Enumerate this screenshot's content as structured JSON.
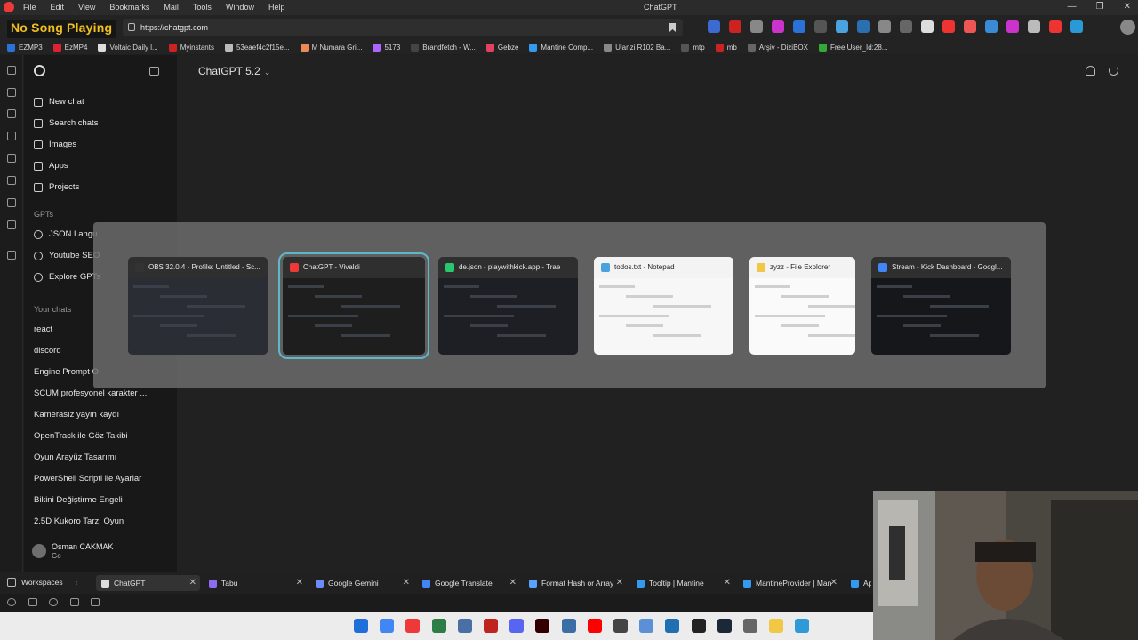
{
  "menubar": {
    "menus": [
      "File",
      "Edit",
      "View",
      "Bookmarks",
      "Mail",
      "Tools",
      "Window",
      "Help"
    ],
    "window_title": "ChatGPT"
  },
  "overlay": {
    "now_playing": "No Song Playing"
  },
  "address": {
    "url": "https://chatgpt.com"
  },
  "bookmarks": [
    {
      "label": "EZMP3",
      "color": "#2a72d8"
    },
    {
      "label": "EzMP4",
      "color": "#d23"
    },
    {
      "label": "Voltaic Daily l...",
      "color": "#ddd"
    },
    {
      "label": "Myinstants",
      "color": "#c22"
    },
    {
      "label": "53eaef4c2f15e...",
      "color": "#bbb"
    },
    {
      "label": "M Numara Gri...",
      "color": "#e85"
    },
    {
      "label": "5173",
      "color": "#a6f"
    },
    {
      "label": "Brandfetch - W...",
      "color": "#444"
    },
    {
      "label": "Gebze",
      "color": "#e4405f"
    },
    {
      "label": "Mantine Comp...",
      "color": "#339af0"
    },
    {
      "label": "Ulanzi R102 Ba...",
      "color": "#888"
    },
    {
      "label": "mtp",
      "color": "#555"
    },
    {
      "label": "mb",
      "color": "#c22"
    },
    {
      "label": "Arşiv - DiziBOX",
      "color": "#666"
    },
    {
      "label": "Free User_Id:28...",
      "color": "#3a3"
    }
  ],
  "sidebar": {
    "nav": [
      {
        "label": "New chat",
        "icon": "edit-icon"
      },
      {
        "label": "Search chats",
        "icon": "search-icon"
      },
      {
        "label": "Images",
        "icon": "image-icon"
      },
      {
        "label": "Apps",
        "icon": "apps-icon"
      },
      {
        "label": "Projects",
        "icon": "folder-icon"
      }
    ],
    "gpts_header": "GPTs",
    "gpts": [
      {
        "label": "JSON Langu"
      },
      {
        "label": "Youtube SEO"
      },
      {
        "label": "Explore GPTs"
      }
    ],
    "chats_header": "Your chats",
    "chats": [
      "react",
      "discord",
      "Engine Prompt O",
      "SCUM profesyonel karakter ...",
      "Kamerasız yayın kaydı",
      "OpenTrack ile Göz Takibi",
      "Oyun Arayüz Tasarımı",
      "PowerShell Scripti ile Ayarlar",
      "Bikini Değiştirme Engeli",
      "2.5D Kukoro Tarzı Oyun"
    ],
    "user": {
      "name": "Osman CAKMAK",
      "plan": "Go"
    }
  },
  "main": {
    "model": "ChatGPT 5.2"
  },
  "switcher": {
    "windows": [
      {
        "title": "OBS 32.0.4 - Profile: Untitled - Sc...",
        "icon": "obs-icon",
        "color": "#333",
        "thumb": "#2a2d33",
        "selected": false,
        "light": false
      },
      {
        "title": "ChatGPT - Vivaldi",
        "icon": "vivaldi-icon",
        "color": "#ef3939",
        "thumb": "#1e1e1e",
        "selected": true,
        "light": false
      },
      {
        "title": "de.json - playwithkick.app - Trae",
        "icon": "trae-icon",
        "color": "#28c76f",
        "thumb": "#1d1f24",
        "selected": false,
        "light": false
      },
      {
        "title": "todos.txt - Notepad",
        "icon": "notepad-icon",
        "color": "#4aa3df",
        "thumb": "#f7f7f7",
        "selected": false,
        "light": true
      },
      {
        "title": "zyzz - File Explorer",
        "icon": "folder-icon",
        "color": "#f2c744",
        "thumb": "#fafafa",
        "selected": false,
        "light": true
      },
      {
        "title": "Stream - Kick Dashboard - Googl...",
        "icon": "chrome-icon",
        "color": "#4285f4",
        "thumb": "#15171a",
        "selected": false,
        "light": false
      }
    ]
  },
  "tabbar": {
    "workspaces_label": "Workspaces",
    "tabs": [
      {
        "label": "ChatGPT",
        "color": "#ddd",
        "active": true
      },
      {
        "label": "Tabu",
        "color": "#8c6cf0",
        "active": false
      },
      {
        "label": "Google Gemini",
        "color": "#6b8cff",
        "active": false
      },
      {
        "label": "Google Translate",
        "color": "#4285f4",
        "active": false
      },
      {
        "label": "Format Hash or Array",
        "color": "#5aa0ff",
        "active": false
      },
      {
        "label": "Tooltip | Mantine",
        "color": "#339af0",
        "active": false
      },
      {
        "label": "MantineProvider | Man",
        "color": "#339af0",
        "active": false
      },
      {
        "label": "App",
        "color": "#339af0",
        "active": false
      }
    ]
  },
  "taskbar": {
    "apps": [
      {
        "name": "windows-start-icon",
        "color": "#1e6fd9"
      },
      {
        "name": "chrome-icon",
        "color": "#4285f4"
      },
      {
        "name": "vivaldi-icon",
        "color": "#ef3939"
      },
      {
        "name": "terminal-icon",
        "color": "#2d7d46"
      },
      {
        "name": "git-icon",
        "color": "#4a6fa5"
      },
      {
        "name": "filezilla-icon",
        "color": "#c0241f"
      },
      {
        "name": "discord-icon",
        "color": "#5865f2"
      },
      {
        "name": "illustrator-icon",
        "color": "#330000"
      },
      {
        "name": "app-icon",
        "color": "#3a6ea5"
      },
      {
        "name": "youtube-music-icon",
        "color": "#ff0000"
      },
      {
        "name": "app2-icon",
        "color": "#444"
      },
      {
        "name": "explorer-icon",
        "color": "#5b8fd6"
      },
      {
        "name": "vscode-icon",
        "color": "#1f6fb2"
      },
      {
        "name": "obs-icon",
        "color": "#222"
      },
      {
        "name": "steam-icon",
        "color": "#1b2838"
      },
      {
        "name": "search-icon",
        "color": "#666"
      },
      {
        "name": "folder-icon",
        "color": "#f2c744"
      },
      {
        "name": "notepad-icon",
        "color": "#2f9ad6"
      }
    ]
  }
}
